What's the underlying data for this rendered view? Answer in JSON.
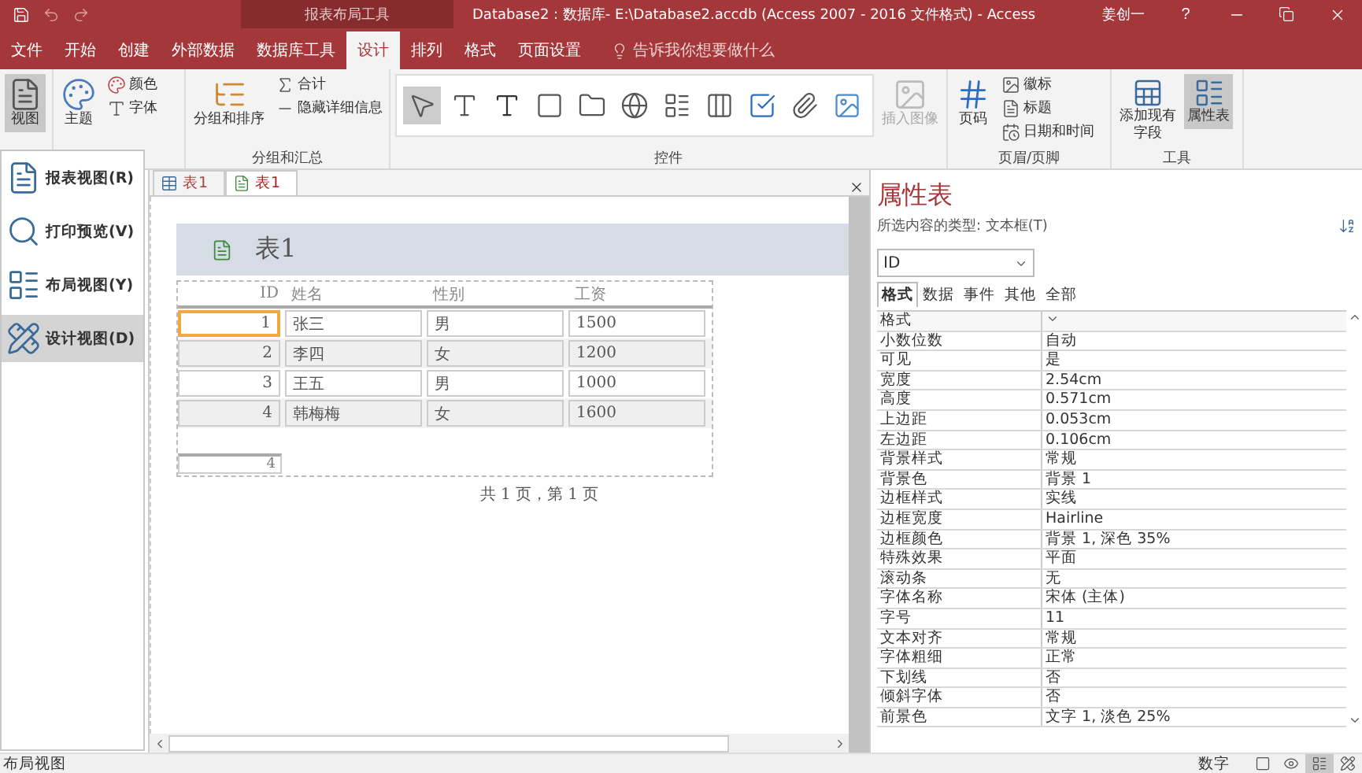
{
  "title_bar": {
    "context_group": "报表布局工具",
    "title": "Database2 : 数据库- E:\\Database2.accdb (Access 2007 - 2016 文件格式)  -  Access",
    "user": "姜创一",
    "help": "?"
  },
  "ribbon_tabs": [
    {
      "label": "文件",
      "selected": false
    },
    {
      "label": "开始",
      "selected": false
    },
    {
      "label": "创建",
      "selected": false
    },
    {
      "label": "外部数据",
      "selected": false
    },
    {
      "label": "数据库工具",
      "selected": false
    },
    {
      "label": "设计",
      "selected": true
    },
    {
      "label": "排列",
      "selected": false
    },
    {
      "label": "格式",
      "selected": false
    },
    {
      "label": "页面设置",
      "selected": false
    }
  ],
  "tell_me": "告诉我你想要做什么",
  "ribbon_groups": [
    {
      "kind": "views",
      "buttons": [
        {
          "label": "视图",
          "pressed": true,
          "disabled": false
        }
      ]
    },
    {
      "kind": "themes",
      "buttons": [
        {
          "label": "主题",
          "pressed": false,
          "disabled": false
        },
        {
          "label": "颜色",
          "pressed": false,
          "disabled": false
        },
        {
          "label": "字体",
          "pressed": false,
          "disabled": false
        }
      ]
    },
    {
      "kind": "grouping",
      "label": "分组和汇总",
      "buttons": [
        {
          "label": "分组和排序",
          "pressed": false,
          "disabled": false
        },
        {
          "label": "合计",
          "pressed": false,
          "disabled": false
        },
        {
          "label": "隐藏详细信息",
          "pressed": false,
          "disabled": false
        }
      ]
    },
    {
      "kind": "controls",
      "label": "控件",
      "buttons": [
        {
          "label": "插入图像",
          "pressed": false,
          "disabled": true
        }
      ]
    },
    {
      "kind": "header_footer",
      "label": "页眉/页脚",
      "buttons": [
        {
          "label": "页码",
          "pressed": false,
          "disabled": false
        },
        {
          "label": "徽标",
          "pressed": false,
          "disabled": false
        },
        {
          "label": "标题",
          "pressed": false,
          "disabled": false
        },
        {
          "label": "日期和时间",
          "pressed": false,
          "disabled": false
        }
      ]
    },
    {
      "kind": "tools",
      "label": "工具",
      "buttons": [
        {
          "label": "添加现有字段",
          "pressed": false,
          "disabled": false
        },
        {
          "label": "属性表",
          "pressed": true,
          "disabled": false
        }
      ]
    }
  ],
  "view_menu": [
    {
      "label": "报表视图(R)",
      "selected": false
    },
    {
      "label": "打印预览(V)",
      "selected": false
    },
    {
      "label": "布局视图(Y)",
      "selected": false
    },
    {
      "label": "设计视图(D)",
      "selected": true
    }
  ],
  "document_tabs": [
    {
      "label": "表1",
      "kind": "table",
      "selected": false
    },
    {
      "label": "表1",
      "kind": "report",
      "selected": true
    }
  ],
  "report": {
    "title": "表1",
    "columns": [
      "ID",
      "姓名",
      "性别",
      "工资"
    ],
    "rows": [
      {
        "cells": [
          "1",
          "张三",
          "男",
          "1500"
        ],
        "selected": true
      },
      {
        "cells": [
          "2",
          "李四",
          "女",
          "1200"
        ],
        "selected": false
      },
      {
        "cells": [
          "3",
          "王五",
          "男",
          "1000"
        ],
        "selected": false
      },
      {
        "cells": [
          "4",
          "韩梅梅",
          "女",
          "1600"
        ],
        "selected": false
      }
    ],
    "count": "4",
    "footer": "共 1 页，第 1 页"
  },
  "property_sheet": {
    "title": "属性表",
    "selection_type": "所选内容的类型: 文本框(T)",
    "object": "ID",
    "tabs": [
      {
        "label": "格式",
        "selected": true
      },
      {
        "label": "数据",
        "selected": false
      },
      {
        "label": "事件",
        "selected": false
      },
      {
        "label": "其他",
        "selected": false
      },
      {
        "label": "全部",
        "selected": false
      }
    ],
    "properties": [
      {
        "name": "格式",
        "focused": true
      },
      {
        "name": "小数位数",
        "value": "自动",
        "focused": false
      },
      {
        "name": "可见",
        "value": "是",
        "focused": false
      },
      {
        "name": "宽度",
        "value": "2.54cm",
        "focused": false
      },
      {
        "name": "高度",
        "value": "0.571cm",
        "focused": false
      },
      {
        "name": "上边距",
        "value": "0.053cm",
        "focused": false
      },
      {
        "name": "左边距",
        "value": "0.106cm",
        "focused": false
      },
      {
        "name": "背景样式",
        "value": "常规",
        "focused": false
      },
      {
        "name": "背景色",
        "value": "背景 1",
        "focused": false
      },
      {
        "name": "边框样式",
        "value": "实线",
        "focused": false
      },
      {
        "name": "边框宽度",
        "value": "Hairline",
        "focused": false
      },
      {
        "name": "边框颜色",
        "value": "背景 1, 深色 35%",
        "focused": false
      },
      {
        "name": "特殊效果",
        "value": "平面",
        "focused": false
      },
      {
        "name": "滚动条",
        "value": "无",
        "focused": false
      },
      {
        "name": "字体名称",
        "value": "宋体 (主体)",
        "focused": false
      },
      {
        "name": "字号",
        "value": "11",
        "focused": false
      },
      {
        "name": "文本对齐",
        "value": "常规",
        "focused": false
      },
      {
        "name": "字体粗细",
        "value": "正常",
        "focused": false
      },
      {
        "name": "下划线",
        "value": "否",
        "focused": false
      },
      {
        "name": "倾斜字体",
        "value": "否",
        "focused": false
      },
      {
        "name": "前景色",
        "value": "文字 1, 淡色 25%",
        "focused": false
      }
    ]
  },
  "status_bar": {
    "mode": "布局视图",
    "indicator": "数字",
    "views": [
      {
        "selected": false
      },
      {
        "selected": false
      },
      {
        "selected": true
      },
      {
        "selected": false
      }
    ]
  }
}
